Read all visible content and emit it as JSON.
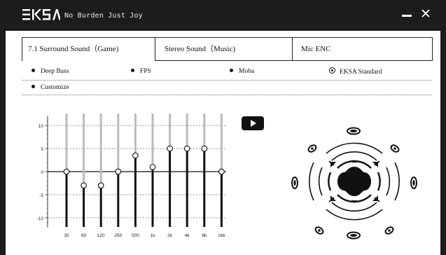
{
  "header": {
    "brand": "EKSA",
    "slogan": "No Burden Just Joy",
    "minimize_icon": "minimize-icon",
    "close_label": "✕"
  },
  "tabs": [
    {
      "label": "7.1 Surround Sound（Game)",
      "active": true
    },
    {
      "label": "Stereo Sound（Music)",
      "active": false
    },
    {
      "label": "Mic ENC",
      "active": false
    }
  ],
  "presets": [
    {
      "label": "Deep Bass",
      "selected": false
    },
    {
      "label": "FPS",
      "selected": false
    },
    {
      "label": "Moba",
      "selected": false
    },
    {
      "label": "EKSA Standard",
      "selected": true
    },
    {
      "label": "Customize",
      "selected": false
    }
  ],
  "equalizer": {
    "y_ticks": [
      "10",
      "5",
      "0",
      "-5",
      "-10"
    ],
    "y_range": [
      -12,
      12
    ],
    "bands": [
      {
        "freq": "30",
        "gain": 0
      },
      {
        "freq": "60",
        "gain": -3
      },
      {
        "freq": "120",
        "gain": -3
      },
      {
        "freq": "250",
        "gain": 0
      },
      {
        "freq": "500",
        "gain": 3.5
      },
      {
        "freq": "1k",
        "gain": 1
      },
      {
        "freq": "2k",
        "gain": 5
      },
      {
        "freq": "4k",
        "gain": 5
      },
      {
        "freq": "8k",
        "gain": 5
      },
      {
        "freq": "16k",
        "gain": 0
      }
    ]
  },
  "play_icon": "play-icon",
  "surround_icon": "surround-sound-speakers-icon",
  "colors": {
    "titlebar": "#1c1c1c",
    "panel": "#ffffff",
    "ink": "#111111"
  }
}
